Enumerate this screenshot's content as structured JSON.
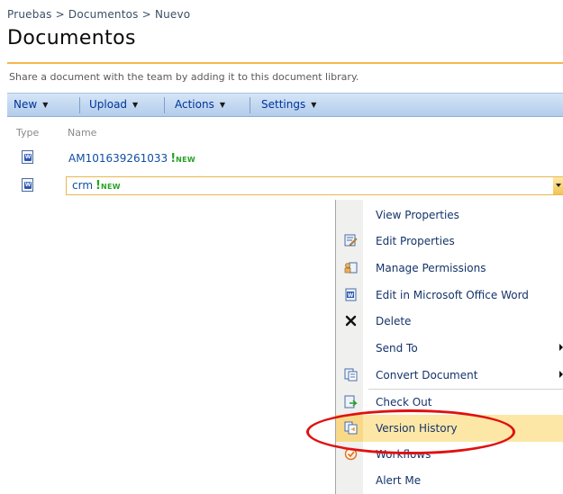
{
  "breadcrumb": {
    "items": [
      "Pruebas",
      "Documentos",
      "Nuevo"
    ],
    "separator": ">"
  },
  "page": {
    "title": "Documentos",
    "description": "Share a document with the team by adding it to this document library."
  },
  "toolbar": {
    "new_label": "New",
    "upload_label": "Upload",
    "actions_label": "Actions",
    "settings_label": "Settings"
  },
  "columns": {
    "type": "Type",
    "name": "Name"
  },
  "rows": [
    {
      "name": "AM101639261033",
      "new_mark": "!",
      "new_label": "NEW",
      "icon": "word-document-icon"
    },
    {
      "name": "crm",
      "new_mark": "!",
      "new_label": "NEW",
      "icon": "word-document-icon"
    }
  ],
  "context_menu": {
    "items": [
      {
        "label": "View Properties",
        "icon": ""
      },
      {
        "label": "Edit Properties",
        "icon": "edit-properties-icon"
      },
      {
        "label": "Manage Permissions",
        "icon": "permissions-icon"
      },
      {
        "label": "Edit in Microsoft Office Word",
        "icon": "word-icon"
      },
      {
        "label": "Delete",
        "icon": "delete-x-icon"
      },
      {
        "label": "Send To",
        "icon": "",
        "submenu": true
      },
      {
        "label": "Convert Document",
        "icon": "convert-document-icon",
        "submenu": true
      },
      {
        "label": "Check Out",
        "icon": "check-out-icon"
      },
      {
        "label": "Version History",
        "icon": "version-history-icon",
        "highlighted": true
      },
      {
        "label": "Workflows",
        "icon": "workflows-icon"
      },
      {
        "label": "Alert Me",
        "icon": ""
      }
    ]
  },
  "colors": {
    "accent_orange": "#f2b64e",
    "toolbar_blue": "#c3d8f1",
    "link_blue": "#104ea3",
    "new_green": "#27a327",
    "highlight": "#fde7a6",
    "annotation_red": "#e01010"
  }
}
